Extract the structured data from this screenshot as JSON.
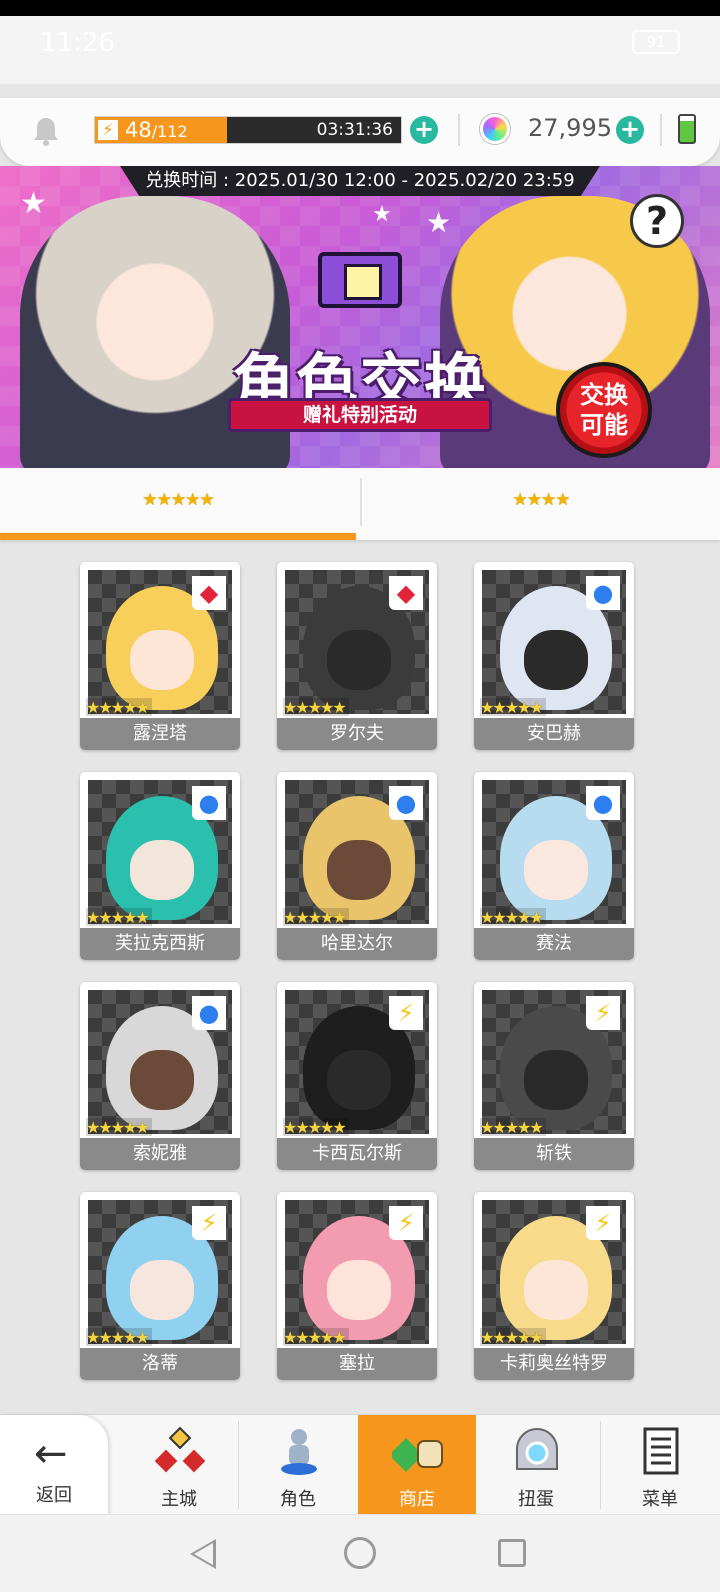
{
  "status_bar": {
    "time": "11:26",
    "battery": "91"
  },
  "resources": {
    "stamina_current": "48",
    "stamina_max": "/112",
    "stamina_fraction": 0.43,
    "stamina_timer": "03:31:36",
    "gems": "27,995"
  },
  "banner": {
    "exchange_time": "兑换时间 : 2025.01/30 12:00 - 2025.02/20 23:59",
    "title": "角色交换",
    "subtitle": "赠礼特别活动",
    "badge": "交换可能",
    "help": "?"
  },
  "tabs": [
    {
      "label": "★★★★★",
      "active": true
    },
    {
      "label": "★★★★",
      "active": false
    }
  ],
  "characters": [
    {
      "name": "露涅塔",
      "stars": "★★★★★",
      "element": "fire",
      "element_glyph": "◆",
      "hair": "#f7cf5a",
      "skin": "light"
    },
    {
      "name": "罗尔夫",
      "stars": "★★★★★",
      "element": "fire",
      "element_glyph": "◆",
      "hair": "#3b3b3b",
      "skin": "mech"
    },
    {
      "name": "安巴赫",
      "stars": "★★★★★",
      "element": "water",
      "element_glyph": "●",
      "hair": "#dfe6f2",
      "skin": "mech"
    },
    {
      "name": "芙拉克西斯",
      "stars": "★★★★★",
      "element": "water",
      "element_glyph": "●",
      "hair": "#2bbfae",
      "skin": "light"
    },
    {
      "name": "哈里达尔",
      "stars": "★★★★★",
      "element": "water",
      "element_glyph": "●",
      "hair": "#e9c46a",
      "skin": "dark"
    },
    {
      "name": "赛法",
      "stars": "★★★★★",
      "element": "water",
      "element_glyph": "●",
      "hair": "#b7dcef",
      "skin": "light"
    },
    {
      "name": "索妮雅",
      "stars": "★★★★★",
      "element": "water",
      "element_glyph": "●",
      "hair": "#d8d8d8",
      "skin": "dark"
    },
    {
      "name": "卡西瓦尔斯",
      "stars": "★★★★★",
      "element": "light",
      "element_glyph": "⚡",
      "hair": "#1e1e1e",
      "skin": "mech"
    },
    {
      "name": "斩铁",
      "stars": "★★★★★",
      "element": "light",
      "element_glyph": "⚡",
      "hair": "#4a4a4a",
      "skin": "mech"
    },
    {
      "name": "洛蒂",
      "stars": "★★★★★",
      "element": "light",
      "element_glyph": "⚡",
      "hair": "#8fd1ee",
      "skin": "light"
    },
    {
      "name": "塞拉",
      "stars": "★★★★★",
      "element": "light",
      "element_glyph": "⚡",
      "hair": "#f39bb0",
      "skin": "light"
    },
    {
      "name": "卡莉奥丝特罗",
      "stars": "★★★★★",
      "element": "light",
      "element_glyph": "⚡",
      "hair": "#f7da8a",
      "skin": "light"
    }
  ],
  "bottom_nav": {
    "back": "返回",
    "items": [
      {
        "label": "主城",
        "icon": "town-icon",
        "active": false
      },
      {
        "label": "角色",
        "icon": "character-icon",
        "active": false
      },
      {
        "label": "商店",
        "icon": "shop-icon",
        "active": true
      },
      {
        "label": "扭蛋",
        "icon": "gacha-icon",
        "active": false
      },
      {
        "label": "菜单",
        "icon": "menu-icon",
        "active": false
      }
    ]
  }
}
